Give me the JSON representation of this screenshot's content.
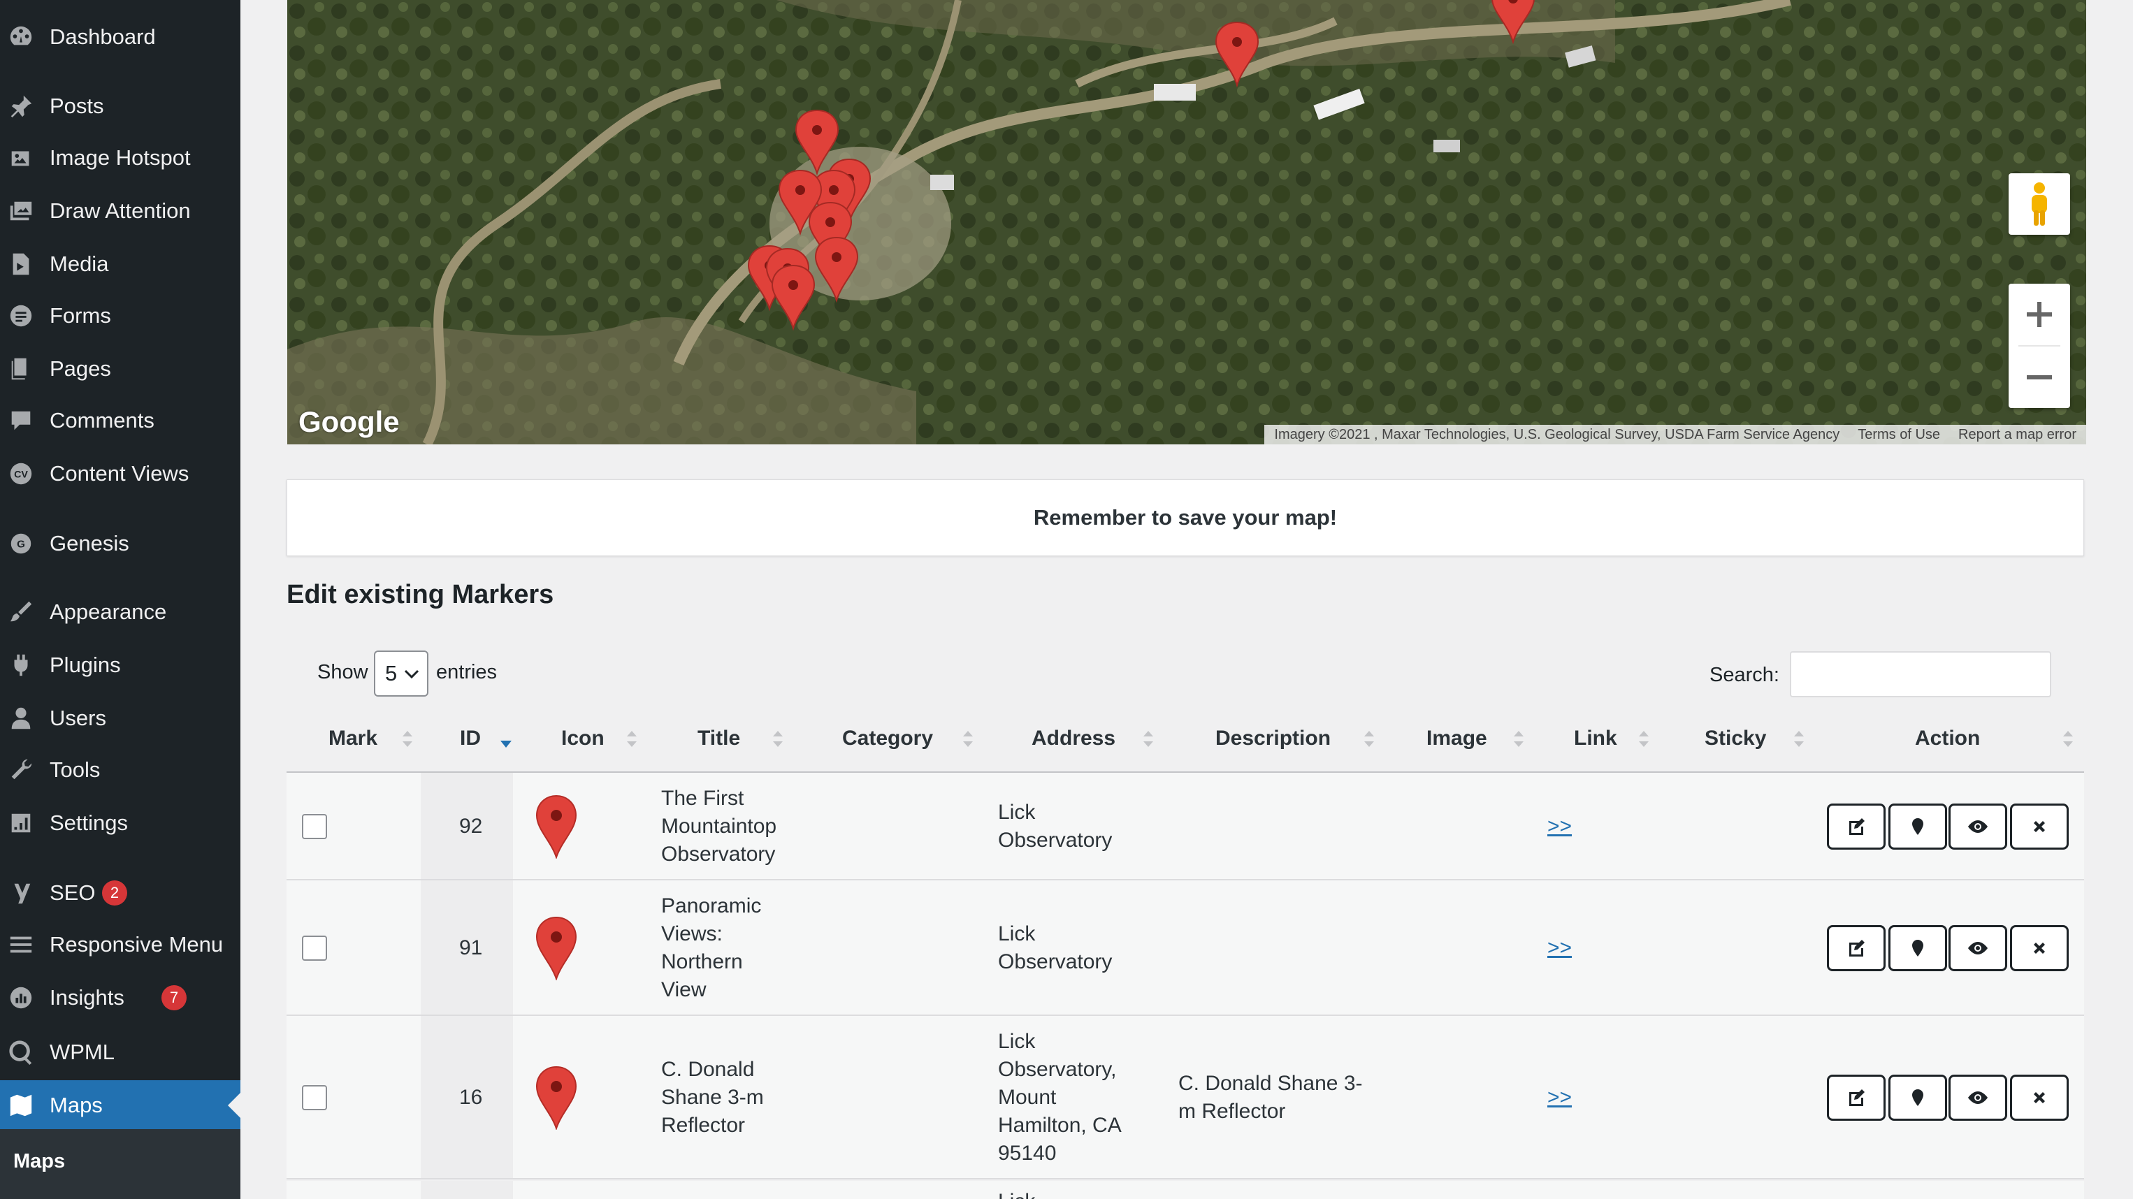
{
  "sidebar": {
    "items": [
      {
        "label": "Dashboard",
        "icon": "dashboard-icon"
      },
      {
        "label": "Posts",
        "icon": "pin-icon"
      },
      {
        "label": "Image Hotspot",
        "icon": "image-icon"
      },
      {
        "label": "Draw Attention",
        "icon": "images-icon"
      },
      {
        "label": "Media",
        "icon": "media-icon"
      },
      {
        "label": "Forms",
        "icon": "forms-icon"
      },
      {
        "label": "Pages",
        "icon": "pages-icon"
      },
      {
        "label": "Comments",
        "icon": "comment-icon"
      },
      {
        "label": "Content Views",
        "icon": "cv-icon"
      },
      {
        "label": "Genesis",
        "icon": "genesis-icon"
      },
      {
        "label": "Appearance",
        "icon": "brush-icon"
      },
      {
        "label": "Plugins",
        "icon": "plugin-icon"
      },
      {
        "label": "Users",
        "icon": "users-icon"
      },
      {
        "label": "Tools",
        "icon": "wrench-icon"
      },
      {
        "label": "Settings",
        "icon": "settings-icon"
      },
      {
        "label": "SEO",
        "icon": "yoast-icon",
        "badge": "2"
      },
      {
        "label": "Responsive Menu",
        "icon": "menu-icon"
      },
      {
        "label": "Insights",
        "icon": "insights-icon",
        "badge": "7"
      },
      {
        "label": "WPML",
        "icon": "wpml-icon"
      },
      {
        "label": "Maps",
        "icon": "maps-icon",
        "current": true
      }
    ],
    "submenu": {
      "label": "Maps"
    }
  },
  "map": {
    "logo": "Google",
    "attribution": "Imagery ©2021 , Maxar Technologies, U.S. Geological Survey, USDA Farm Service Agency",
    "terms": "Terms of Use",
    "report": "Report a map error",
    "zoom_in": "+",
    "zoom_out": "−"
  },
  "notice": "Remember to save your map!",
  "section_title": "Edit existing Markers",
  "controls": {
    "show_label": "Show",
    "entries_value": "5",
    "entries_label": "entries",
    "search_label": "Search:"
  },
  "table": {
    "columns": [
      "Mark",
      "ID",
      "Icon",
      "Title",
      "Category",
      "Address",
      "Description",
      "Image",
      "Link",
      "Sticky",
      "Action"
    ],
    "rows": [
      {
        "id": "92",
        "title": [
          "The First",
          "Mountaintop",
          "Observatory"
        ],
        "address": [
          "Lick",
          "Observatory"
        ],
        "description": [],
        "link": ">>"
      },
      {
        "id": "91",
        "title": [
          "Panoramic",
          "Views:",
          "Northern",
          "View"
        ],
        "address": [
          "Lick",
          "Observatory"
        ],
        "description": [],
        "link": ">>"
      },
      {
        "id": "16",
        "title": [
          "C. Donald",
          "Shane 3-m",
          "Reflector"
        ],
        "address": [
          "Lick",
          "Observatory,",
          "Mount",
          "Hamilton, CA",
          "95140"
        ],
        "description": [
          "C. Donald Shane 3-",
          "m Reflector"
        ],
        "link": ">>"
      }
    ],
    "partial_row_text": "Lick"
  },
  "colors": {
    "sidebar_bg": "#1d2327",
    "accent": "#2271b1",
    "badge": "#d63638",
    "marker": "#e0413a"
  }
}
